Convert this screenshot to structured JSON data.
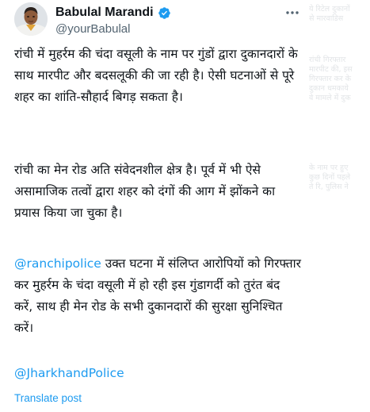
{
  "background_text": {
    "line1": "ये रिटेल दुकानों",
    "line2": "से मारवाडिस",
    "line3": "रांची गिरफ्तार",
    "line4": "मारपीट की, इस",
    "line5": "गिरफ्तार कर के",
    "line6": "दुकान धमकाये",
    "line7": "वे मामले में दुक",
    "line8": "के नाम पर हुए",
    "line9": "कुछ दिनों पहले",
    "line10": "ते रि, पुलिस ने"
  },
  "tweet": {
    "author_name": "Babulal Marandi",
    "author_handle": "@yourBabulal",
    "paragraph1": "रांची में मुहर्रम की चंदा वसूली के नाम पर गुंडों द्वारा दुकानदारों के साथ मारपीट और बदसलूकी की जा रही है। ऐसी घटनाओं से पूरे शहर का शांति-सौहार्द बिगड़ सकता है।",
    "paragraph2": "रांची का मेन रोड अति संवेदनशील क्षेत्र है। पूर्व में भी ऐसे असामाजिक तत्वों द्वारा शहर को दंगों की आग में झोंकने का प्रयास किया जा चुका है।",
    "paragraph3_mention": "@ranchipolice",
    "paragraph3_text": " उक्त घटना में संलिप्त आरोपियों को गिरफ्तार कर मुहर्रम के चंदा वसूली में हो रही इस गुंडागर्दी को तुरंत बंद करें, साथ ही मेन रोड के सभी दुकानदारों की सुरक्षा सुनिश्चित करें।",
    "paragraph4_mention": "@JharkhandPolice",
    "translate_label": "Translate post"
  },
  "icons": {
    "verified": "verified-badge-icon",
    "more": "more-options-icon"
  },
  "colors": {
    "text": "#0f1419",
    "secondary": "#536471",
    "link": "#1d9bf0",
    "verified": "#1d9bf0"
  }
}
